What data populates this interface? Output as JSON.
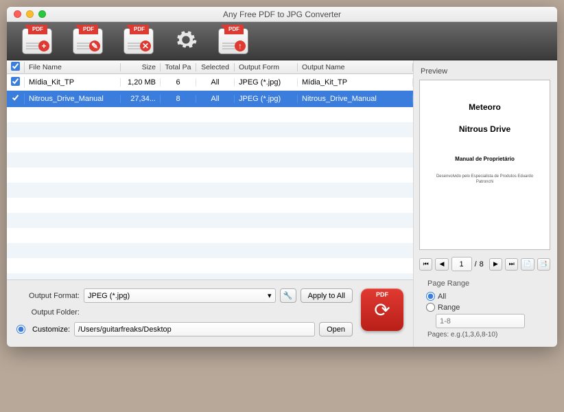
{
  "window_title": "Any Free PDF to JPG Converter",
  "toolbar_icons": {
    "add": "+",
    "edit": "✎",
    "remove": "✕",
    "settings": "⚙",
    "export": "↑",
    "pdf_badge": "PDF"
  },
  "table": {
    "headers": {
      "checkbox": "",
      "name": "File Name",
      "size": "Size",
      "pages": "Total Pa",
      "selected": "Selected",
      "format": "Output Form",
      "output": "Output Name"
    },
    "rows": [
      {
        "checked": true,
        "name": "Mídia_Kit_TP",
        "size": "1,20 MB",
        "pages": "6",
        "selected": "All",
        "format": "JPEG (*.jpg)",
        "output": "Mídia_Kit_TP",
        "sel": false
      },
      {
        "checked": true,
        "name": "Nitrous_Drive_Manual",
        "size": "27,34...",
        "pages": "8",
        "selected": "All",
        "format": "JPEG (*.jpg)",
        "output": "Nitrous_Drive_Manual",
        "sel": true
      }
    ]
  },
  "output": {
    "format_label": "Output Format:",
    "format_value": "JPEG (*.jpg)",
    "apply_all": "Apply to All",
    "folder_label": "Output Folder:",
    "customize_radio": "Customize:",
    "customize_path": "/Users/guitarfreaks/Desktop",
    "open_btn": "Open",
    "pdf_label": "PDF"
  },
  "preview": {
    "label": "Preview",
    "doc": {
      "title1": "Meteoro",
      "title2": "Nitrous Drive",
      "subtitle": "Manual de Proprietário",
      "footer": "Desenvolvido pelo Especialista de Produtos\nEduardo Patronchi"
    },
    "pager": {
      "current": "1",
      "total": "8",
      "sep": "/"
    }
  },
  "page_range": {
    "title": "Page Range",
    "all": "All",
    "range": "Range",
    "range_placeholder": "1-8",
    "hint": "Pages: e.g.(1,3,6,8-10)"
  }
}
